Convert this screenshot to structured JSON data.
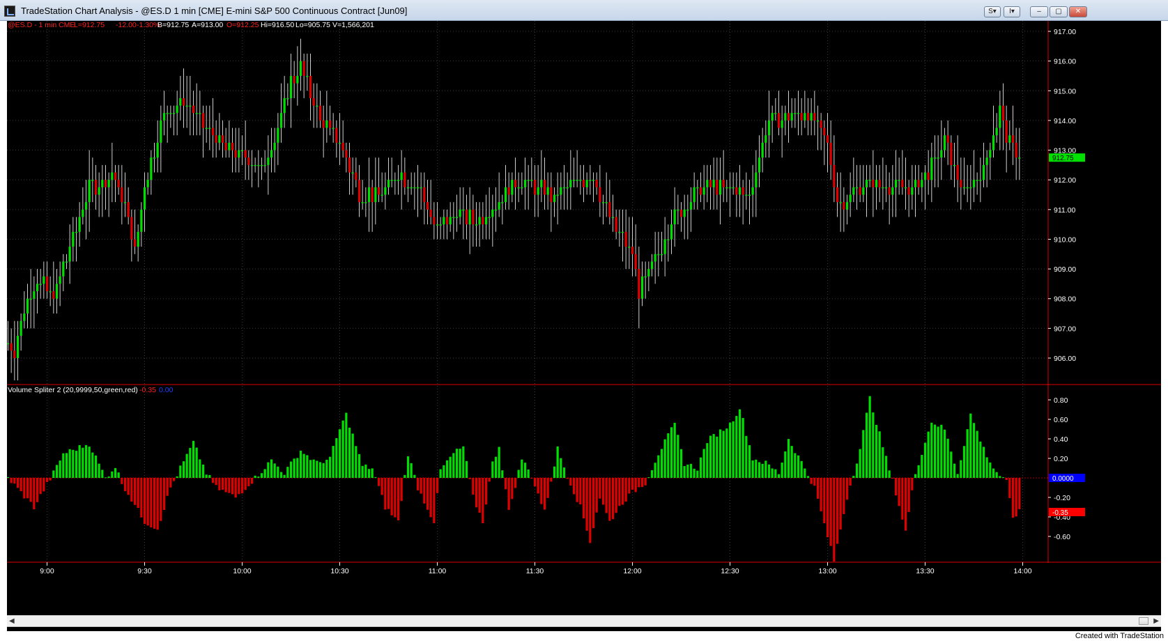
{
  "window": {
    "title": "TradeStation Chart Analysis - @ES.D 1 min [CME] E-mini S&P 500 Continuous Contract [Jun09]",
    "buttons": {
      "s_label": "S▾",
      "i_label": "I▾",
      "minimize": "–",
      "maximize": "▢",
      "close": "✕"
    }
  },
  "quote": {
    "symbol": "@ES.D - 1 min  CME",
    "last": "L=912.75",
    "change": "-12.00",
    "pct_change": "-1.30%",
    "bid": "B=912.75",
    "ask": "A=913.00",
    "open": "O=912.25",
    "high": "Hi=916.50",
    "low": "Lo=905.75",
    "volume": "V=1,566,201"
  },
  "indicator": {
    "label": "Volume Spliter 2 (20,9999,50,green,red)",
    "value1": "-0.35",
    "value2": "0.00"
  },
  "price_axis": {
    "ticks": [
      "917.00",
      "916.00",
      "915.00",
      "914.00",
      "913.00",
      "912.00",
      "911.00",
      "910.00",
      "909.00",
      "908.00",
      "907.00",
      "906.00"
    ],
    "last_marker": "912.75"
  },
  "indicator_axis": {
    "ticks": [
      "0.80",
      "0.60",
      "0.40",
      "0.20",
      "-0.20",
      "-0.40",
      "-0.60"
    ],
    "zero_marker": "0.0000",
    "value_marker": "-0.35"
  },
  "time_axis": {
    "labels": [
      "9:00",
      "9:30",
      "10:00",
      "10:30",
      "11:00",
      "11:30",
      "12:00",
      "12:30",
      "13:00",
      "13:30",
      "14:00"
    ]
  },
  "footer": {
    "credit": "Created with TradeStation"
  },
  "colors": {
    "up": "#00e000",
    "down": "#e00000",
    "background": "#000000",
    "text": "#ffffff",
    "accent_red": "#ff2020",
    "accent_blue": "#0000ff"
  },
  "chart_data": [
    {
      "type": "candlestick",
      "title": "@ES.D - 1 min  CME",
      "ylim": [
        905.5,
        917.2
      ],
      "x_start": "8:48",
      "interval_minutes": 1,
      "close_keypoints": [
        {
          "time": "8:48",
          "price": 906.5
        },
        {
          "time": "8:50",
          "price": 906.3
        },
        {
          "time": "8:53",
          "price": 907.7
        },
        {
          "time": "8:57",
          "price": 908.6
        },
        {
          "time": "9:02",
          "price": 908.1
        },
        {
          "time": "9:07",
          "price": 909.7
        },
        {
          "time": "9:13",
          "price": 911.7
        },
        {
          "time": "9:20",
          "price": 912.2
        },
        {
          "time": "9:24",
          "price": 911.1
        },
        {
          "time": "9:27",
          "price": 909.6
        },
        {
          "time": "9:30",
          "price": 911.8
        },
        {
          "time": "9:36",
          "price": 914.2
        },
        {
          "time": "9:42",
          "price": 914.7
        },
        {
          "time": "9:48",
          "price": 913.9
        },
        {
          "time": "9:54",
          "price": 913.1
        },
        {
          "time": "10:00",
          "price": 912.8
        },
        {
          "time": "10:06",
          "price": 912.3
        },
        {
          "time": "10:10",
          "price": 913.4
        },
        {
          "time": "10:15",
          "price": 915.3
        },
        {
          "time": "10:18",
          "price": 915.8
        },
        {
          "time": "10:24",
          "price": 914.0
        },
        {
          "time": "10:30",
          "price": 913.3
        },
        {
          "time": "10:36",
          "price": 911.6
        },
        {
          "time": "10:42",
          "price": 911.5
        },
        {
          "time": "10:48",
          "price": 912.2
        },
        {
          "time": "10:54",
          "price": 911.8
        },
        {
          "time": "11:00",
          "price": 910.3
        },
        {
          "time": "11:06",
          "price": 910.9
        },
        {
          "time": "11:12",
          "price": 910.6
        },
        {
          "time": "11:18",
          "price": 911.2
        },
        {
          "time": "11:24",
          "price": 912.0
        },
        {
          "time": "11:30",
          "price": 911.8
        },
        {
          "time": "11:36",
          "price": 911.4
        },
        {
          "time": "11:42",
          "price": 911.9
        },
        {
          "time": "11:48",
          "price": 912.1
        },
        {
          "time": "11:54",
          "price": 910.5
        },
        {
          "time": "12:00",
          "price": 909.5
        },
        {
          "time": "12:02",
          "price": 908.3
        },
        {
          "time": "12:06",
          "price": 909.0
        },
        {
          "time": "12:12",
          "price": 910.6
        },
        {
          "time": "12:18",
          "price": 911.4
        },
        {
          "time": "12:24",
          "price": 911.8
        },
        {
          "time": "12:30",
          "price": 911.7
        },
        {
          "time": "12:36",
          "price": 911.4
        },
        {
          "time": "12:40",
          "price": 913.3
        },
        {
          "time": "12:42",
          "price": 914.1
        },
        {
          "time": "12:48",
          "price": 914.1
        },
        {
          "time": "12:54",
          "price": 914.3
        },
        {
          "time": "13:00",
          "price": 913.2
        },
        {
          "time": "13:03",
          "price": 911.2
        },
        {
          "time": "13:08",
          "price": 911.6
        },
        {
          "time": "13:14",
          "price": 911.9
        },
        {
          "time": "13:20",
          "price": 911.8
        },
        {
          "time": "13:26",
          "price": 911.6
        },
        {
          "time": "13:33",
          "price": 912.6
        },
        {
          "time": "13:36",
          "price": 913.3
        },
        {
          "time": "13:42",
          "price": 911.6
        },
        {
          "time": "13:48",
          "price": 912.4
        },
        {
          "time": "13:53",
          "price": 914.3
        },
        {
          "time": "13:56",
          "price": 913.2
        },
        {
          "time": "13:59",
          "price": 912.75
        }
      ]
    },
    {
      "type": "bar",
      "title": "Volume Spliter 2 (20,9999,50,green,red)",
      "ylim": [
        -0.85,
        0.85
      ],
      "x_start": "8:48",
      "interval_minutes": 1,
      "value_keypoints": [
        {
          "time": "8:48",
          "value": 0.0
        },
        {
          "time": "8:56",
          "value": -0.3
        },
        {
          "time": "9:02",
          "value": 0.05
        },
        {
          "time": "9:05",
          "value": 0.25
        },
        {
          "time": "9:13",
          "value": 0.35
        },
        {
          "time": "9:18",
          "value": 0.0
        },
        {
          "time": "9:21",
          "value": 0.12
        },
        {
          "time": "9:23",
          "value": -0.05
        },
        {
          "time": "9:30",
          "value": -0.45
        },
        {
          "time": "9:34",
          "value": -0.52
        },
        {
          "time": "9:38",
          "value": -0.1
        },
        {
          "time": "9:41",
          "value": 0.1
        },
        {
          "time": "9:45",
          "value": 0.36
        },
        {
          "time": "9:49",
          "value": 0.05
        },
        {
          "time": "9:52",
          "value": -0.1
        },
        {
          "time": "9:58",
          "value": -0.2
        },
        {
          "time": "10:04",
          "value": 0.0
        },
        {
          "time": "10:09",
          "value": 0.18
        },
        {
          "time": "10:13",
          "value": 0.05
        },
        {
          "time": "10:18",
          "value": 0.28
        },
        {
          "time": "10:23",
          "value": 0.15
        },
        {
          "time": "10:27",
          "value": 0.2
        },
        {
          "time": "10:30",
          "value": 0.5
        },
        {
          "time": "10:32",
          "value": 0.65
        },
        {
          "time": "10:37",
          "value": 0.12
        },
        {
          "time": "10:40",
          "value": 0.1
        },
        {
          "time": "10:44",
          "value": -0.3
        },
        {
          "time": "10:48",
          "value": -0.45
        },
        {
          "time": "10:51",
          "value": 0.25
        },
        {
          "time": "10:54",
          "value": -0.1
        },
        {
          "time": "10:59",
          "value": -0.45
        },
        {
          "time": "11:01",
          "value": 0.08
        },
        {
          "time": "11:05",
          "value": 0.25
        },
        {
          "time": "11:08",
          "value": 0.32
        },
        {
          "time": "11:11",
          "value": -0.2
        },
        {
          "time": "11:14",
          "value": -0.45
        },
        {
          "time": "11:17",
          "value": 0.15
        },
        {
          "time": "11:19",
          "value": 0.33
        },
        {
          "time": "11:22",
          "value": -0.35
        },
        {
          "time": "11:26",
          "value": 0.2
        },
        {
          "time": "11:29",
          "value": 0.02
        },
        {
          "time": "11:33",
          "value": -0.35
        },
        {
          "time": "11:37",
          "value": 0.3
        },
        {
          "time": "11:40",
          "value": 0.02
        },
        {
          "time": "11:44",
          "value": -0.3
        },
        {
          "time": "11:47",
          "value": -0.65
        },
        {
          "time": "11:50",
          "value": -0.2
        },
        {
          "time": "11:53",
          "value": -0.45
        },
        {
          "time": "11:57",
          "value": -0.25
        },
        {
          "time": "12:00",
          "value": -0.15
        },
        {
          "time": "12:04",
          "value": -0.05
        },
        {
          "time": "12:08",
          "value": 0.25
        },
        {
          "time": "12:13",
          "value": 0.55
        },
        {
          "time": "12:16",
          "value": 0.15
        },
        {
          "time": "12:20",
          "value": 0.1
        },
        {
          "time": "12:23",
          "value": 0.38
        },
        {
          "time": "12:30",
          "value": 0.55
        },
        {
          "time": "12:33",
          "value": 0.72
        },
        {
          "time": "12:37",
          "value": 0.2
        },
        {
          "time": "12:41",
          "value": 0.15
        },
        {
          "time": "12:45",
          "value": 0.05
        },
        {
          "time": "12:48",
          "value": 0.4
        },
        {
          "time": "12:53",
          "value": 0.1
        },
        {
          "time": "12:56",
          "value": -0.1
        },
        {
          "time": "13:00",
          "value": -0.6
        },
        {
          "time": "13:02",
          "value": -0.85
        },
        {
          "time": "13:06",
          "value": -0.2
        },
        {
          "time": "13:10",
          "value": 0.3
        },
        {
          "time": "13:13",
          "value": 0.82
        },
        {
          "time": "13:18",
          "value": 0.2
        },
        {
          "time": "13:21",
          "value": -0.15
        },
        {
          "time": "13:24",
          "value": -0.55
        },
        {
          "time": "13:27",
          "value": 0.05
        },
        {
          "time": "13:32",
          "value": 0.58
        },
        {
          "time": "13:36",
          "value": 0.5
        },
        {
          "time": "13:40",
          "value": 0.05
        },
        {
          "time": "13:44",
          "value": 0.65
        },
        {
          "time": "13:48",
          "value": 0.3
        },
        {
          "time": "13:51",
          "value": 0.1
        },
        {
          "time": "13:55",
          "value": -0.05
        },
        {
          "time": "13:57",
          "value": -0.4
        },
        {
          "time": "13:59",
          "value": -0.35
        }
      ]
    }
  ]
}
